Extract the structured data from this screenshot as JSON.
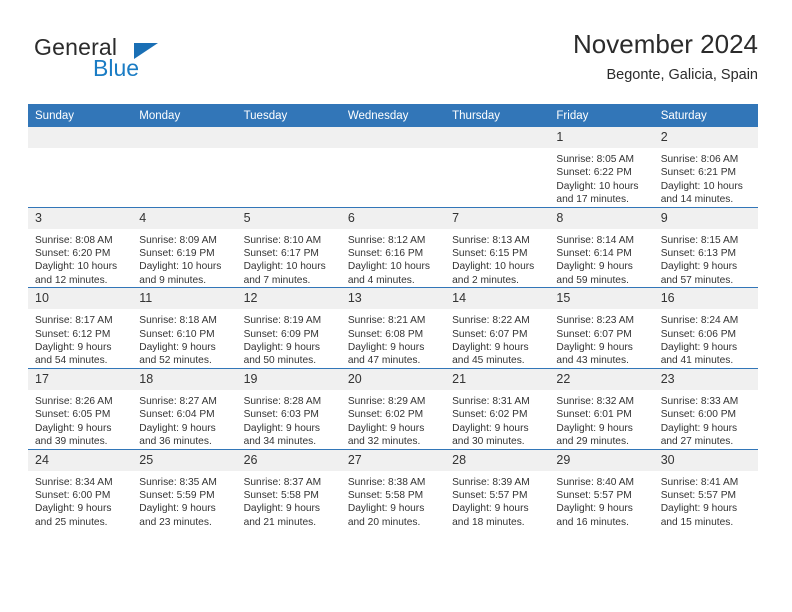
{
  "brand": {
    "word_one": "General",
    "word_two": "Blue",
    "triangle_icon": "triangle-logo-icon"
  },
  "header": {
    "title": "November 2024",
    "subtitle": "Begonte, Galicia, Spain"
  },
  "colors": {
    "header_blue": "#3276b8",
    "brand_blue": "#1a7cc4",
    "daynum_bg": "#f0f0f0",
    "text": "#333333"
  },
  "calendar": {
    "weekday_headers": [
      "Sunday",
      "Monday",
      "Tuesday",
      "Wednesday",
      "Thursday",
      "Friday",
      "Saturday"
    ],
    "weeks": [
      [
        {
          "day": "",
          "lines": []
        },
        {
          "day": "",
          "lines": []
        },
        {
          "day": "",
          "lines": []
        },
        {
          "day": "",
          "lines": []
        },
        {
          "day": "",
          "lines": []
        },
        {
          "day": "1",
          "lines": [
            "Sunrise: 8:05 AM",
            "Sunset: 6:22 PM",
            "Daylight: 10 hours and 17 minutes."
          ]
        },
        {
          "day": "2",
          "lines": [
            "Sunrise: 8:06 AM",
            "Sunset: 6:21 PM",
            "Daylight: 10 hours and 14 minutes."
          ]
        }
      ],
      [
        {
          "day": "3",
          "lines": [
            "Sunrise: 8:08 AM",
            "Sunset: 6:20 PM",
            "Daylight: 10 hours and 12 minutes."
          ]
        },
        {
          "day": "4",
          "lines": [
            "Sunrise: 8:09 AM",
            "Sunset: 6:19 PM",
            "Daylight: 10 hours and 9 minutes."
          ]
        },
        {
          "day": "5",
          "lines": [
            "Sunrise: 8:10 AM",
            "Sunset: 6:17 PM",
            "Daylight: 10 hours and 7 minutes."
          ]
        },
        {
          "day": "6",
          "lines": [
            "Sunrise: 8:12 AM",
            "Sunset: 6:16 PM",
            "Daylight: 10 hours and 4 minutes."
          ]
        },
        {
          "day": "7",
          "lines": [
            "Sunrise: 8:13 AM",
            "Sunset: 6:15 PM",
            "Daylight: 10 hours and 2 minutes."
          ]
        },
        {
          "day": "8",
          "lines": [
            "Sunrise: 8:14 AM",
            "Sunset: 6:14 PM",
            "Daylight: 9 hours and 59 minutes."
          ]
        },
        {
          "day": "9",
          "lines": [
            "Sunrise: 8:15 AM",
            "Sunset: 6:13 PM",
            "Daylight: 9 hours and 57 minutes."
          ]
        }
      ],
      [
        {
          "day": "10",
          "lines": [
            "Sunrise: 8:17 AM",
            "Sunset: 6:12 PM",
            "Daylight: 9 hours and 54 minutes."
          ]
        },
        {
          "day": "11",
          "lines": [
            "Sunrise: 8:18 AM",
            "Sunset: 6:10 PM",
            "Daylight: 9 hours and 52 minutes."
          ]
        },
        {
          "day": "12",
          "lines": [
            "Sunrise: 8:19 AM",
            "Sunset: 6:09 PM",
            "Daylight: 9 hours and 50 minutes."
          ]
        },
        {
          "day": "13",
          "lines": [
            "Sunrise: 8:21 AM",
            "Sunset: 6:08 PM",
            "Daylight: 9 hours and 47 minutes."
          ]
        },
        {
          "day": "14",
          "lines": [
            "Sunrise: 8:22 AM",
            "Sunset: 6:07 PM",
            "Daylight: 9 hours and 45 minutes."
          ]
        },
        {
          "day": "15",
          "lines": [
            "Sunrise: 8:23 AM",
            "Sunset: 6:07 PM",
            "Daylight: 9 hours and 43 minutes."
          ]
        },
        {
          "day": "16",
          "lines": [
            "Sunrise: 8:24 AM",
            "Sunset: 6:06 PM",
            "Daylight: 9 hours and 41 minutes."
          ]
        }
      ],
      [
        {
          "day": "17",
          "lines": [
            "Sunrise: 8:26 AM",
            "Sunset: 6:05 PM",
            "Daylight: 9 hours and 39 minutes."
          ]
        },
        {
          "day": "18",
          "lines": [
            "Sunrise: 8:27 AM",
            "Sunset: 6:04 PM",
            "Daylight: 9 hours and 36 minutes."
          ]
        },
        {
          "day": "19",
          "lines": [
            "Sunrise: 8:28 AM",
            "Sunset: 6:03 PM",
            "Daylight: 9 hours and 34 minutes."
          ]
        },
        {
          "day": "20",
          "lines": [
            "Sunrise: 8:29 AM",
            "Sunset: 6:02 PM",
            "Daylight: 9 hours and 32 minutes."
          ]
        },
        {
          "day": "21",
          "lines": [
            "Sunrise: 8:31 AM",
            "Sunset: 6:02 PM",
            "Daylight: 9 hours and 30 minutes."
          ]
        },
        {
          "day": "22",
          "lines": [
            "Sunrise: 8:32 AM",
            "Sunset: 6:01 PM",
            "Daylight: 9 hours and 29 minutes."
          ]
        },
        {
          "day": "23",
          "lines": [
            "Sunrise: 8:33 AM",
            "Sunset: 6:00 PM",
            "Daylight: 9 hours and 27 minutes."
          ]
        }
      ],
      [
        {
          "day": "24",
          "lines": [
            "Sunrise: 8:34 AM",
            "Sunset: 6:00 PM",
            "Daylight: 9 hours and 25 minutes."
          ]
        },
        {
          "day": "25",
          "lines": [
            "Sunrise: 8:35 AM",
            "Sunset: 5:59 PM",
            "Daylight: 9 hours and 23 minutes."
          ]
        },
        {
          "day": "26",
          "lines": [
            "Sunrise: 8:37 AM",
            "Sunset: 5:58 PM",
            "Daylight: 9 hours and 21 minutes."
          ]
        },
        {
          "day": "27",
          "lines": [
            "Sunrise: 8:38 AM",
            "Sunset: 5:58 PM",
            "Daylight: 9 hours and 20 minutes."
          ]
        },
        {
          "day": "28",
          "lines": [
            "Sunrise: 8:39 AM",
            "Sunset: 5:57 PM",
            "Daylight: 9 hours and 18 minutes."
          ]
        },
        {
          "day": "29",
          "lines": [
            "Sunrise: 8:40 AM",
            "Sunset: 5:57 PM",
            "Daylight: 9 hours and 16 minutes."
          ]
        },
        {
          "day": "30",
          "lines": [
            "Sunrise: 8:41 AM",
            "Sunset: 5:57 PM",
            "Daylight: 9 hours and 15 minutes."
          ]
        }
      ]
    ]
  }
}
